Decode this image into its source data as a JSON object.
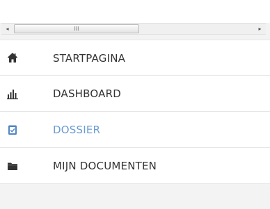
{
  "scrollbar": {
    "left_arrow": "◂",
    "right_arrow": "▸",
    "grip": "III"
  },
  "menu": {
    "items": [
      {
        "label": "STARTPAGINA",
        "icon": "home-icon",
        "active": false
      },
      {
        "label": "DASHBOARD",
        "icon": "bar-chart-icon",
        "active": false
      },
      {
        "label": "DOSSIER",
        "icon": "clipboard-icon",
        "active": true
      },
      {
        "label": "MIJN DOCUMENTEN",
        "icon": "folder-icon",
        "active": false
      }
    ]
  },
  "colors": {
    "text": "#333333",
    "active_text": "#6a9bd2",
    "icon": "#333333",
    "active_icon": "#4f86c6",
    "background": "#f3f3f3"
  }
}
